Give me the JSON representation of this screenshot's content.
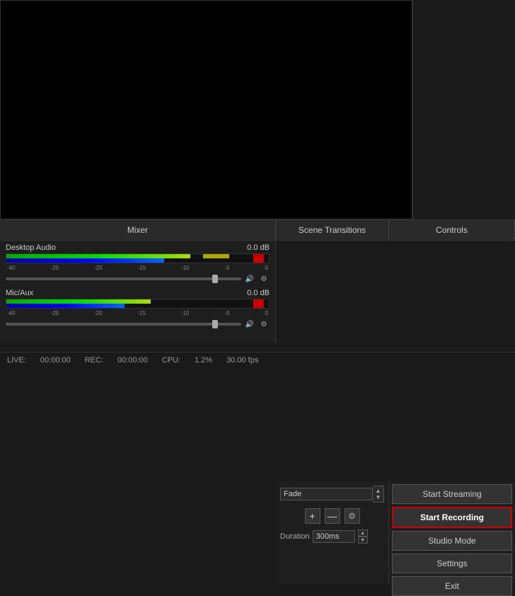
{
  "preview": {
    "main_bg": "#000000",
    "side_bg": "#1a1a1a"
  },
  "sections": {
    "mixer_label": "Mixer",
    "transitions_label": "Scene Transitions",
    "controls_label": "Controls"
  },
  "mixer": {
    "channels": [
      {
        "name": "Desktop Audio",
        "db": "0.0 dB",
        "scale": [
          "-40",
          "-25",
          "-20",
          "-15",
          "-10",
          "-5",
          "0"
        ]
      },
      {
        "name": "Mic/Aux",
        "db": "0.0 dB",
        "scale": [
          "-40",
          "-25",
          "-20",
          "-15",
          "-10",
          "-5",
          "0"
        ]
      }
    ]
  },
  "transitions": {
    "fade_label": "Fade",
    "plus_label": "+",
    "minus_label": "—",
    "gear_label": "⚙",
    "duration_label": "Duration",
    "duration_value": "300ms"
  },
  "controls": {
    "start_streaming_label": "Start Streaming",
    "start_recording_label": "Start Recording",
    "studio_mode_label": "Studio Mode",
    "settings_label": "Settings",
    "exit_label": "Exit"
  },
  "statusbar": {
    "live_label": "LIVE:",
    "live_time": "00:00:00",
    "rec_label": "REC:",
    "rec_time": "00:00:00",
    "cpu_label": "CPU:",
    "cpu_value": "1.2%",
    "fps": "30.00 fps"
  }
}
